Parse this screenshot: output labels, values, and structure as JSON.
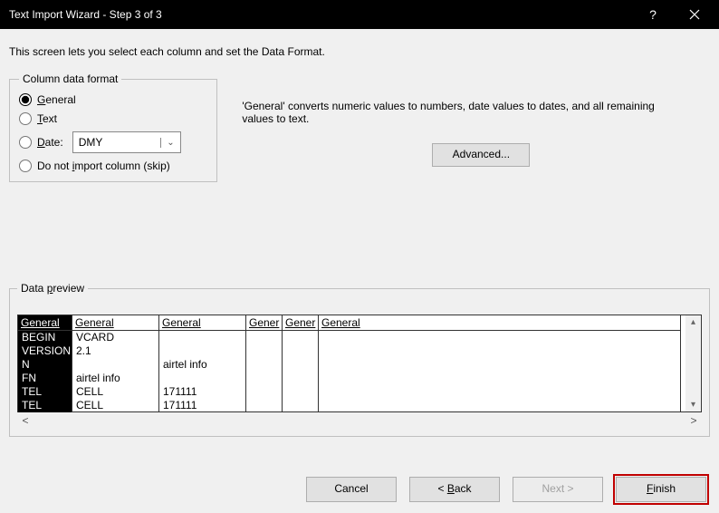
{
  "title": "Text Import Wizard - Step 3 of 3",
  "description": "This screen lets you select each column and set the Data Format.",
  "group": {
    "legend": "Column data format",
    "general": "General",
    "text": "Text",
    "date": "Date:",
    "date_format": "DMY",
    "skip": "Do not import column (skip)"
  },
  "info": "'General' converts numeric values to numbers, date values to dates, and all remaining values to text.",
  "advanced": "Advanced...",
  "preview": {
    "legend": "Data preview",
    "headers": [
      "General",
      "General",
      "General",
      "Gener",
      "Gener",
      "General"
    ],
    "rows": [
      [
        "BEGIN",
        "VCARD",
        "",
        "",
        "",
        ""
      ],
      [
        "VERSION",
        "2.1",
        "",
        "",
        "",
        ""
      ],
      [
        "N",
        "",
        "airtel info",
        "",
        "",
        ""
      ],
      [
        "FN",
        "airtel info",
        "",
        "",
        "",
        ""
      ],
      [
        "TEL",
        "CELL",
        "171111",
        "",
        "",
        ""
      ],
      [
        "TEL",
        "CELL",
        "171111",
        "",
        "",
        ""
      ]
    ]
  },
  "buttons": {
    "cancel": "Cancel",
    "back": "< Back",
    "next": "Next >",
    "finish": "Finish"
  }
}
